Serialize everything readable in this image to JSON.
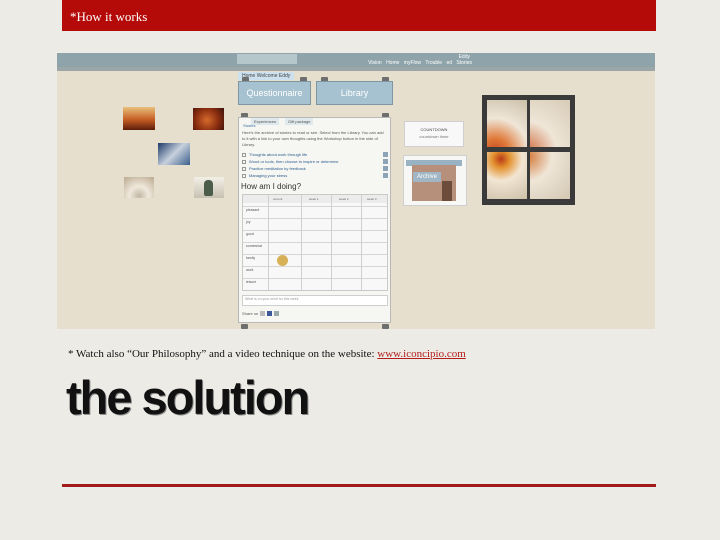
{
  "slide": {
    "title": "*How it works",
    "footnote_prefix": "* Watch also “Our Philosophy” and a video technique on the website: ",
    "footnote_link": "www.iconcipio.com",
    "heading": "the solution"
  },
  "screenshot": {
    "topbar": {
      "user": "Eddy",
      "nav": "Vision  Home  myFlow  Trouble ed  Stories"
    },
    "crumb": "Home  Welcome Eddy",
    "tabs": [
      "Questionnaire",
      "Library"
    ],
    "panel": {
      "tabs": [
        "Experiences",
        "Gift package"
      ],
      "subtab": "Stories",
      "intro": "Here's the archive of stories to read or see. Select from the Library. You can add to it with a link to your own thoughts using the Workshop button in the side of Library.",
      "items": [
        "Thoughts about work through life",
        "Wood or tools, then choose to inspire or determine",
        "Practice meditation by feedback",
        "Managing your stress"
      ],
      "doing_title": "How am I doing?",
      "grid_headers": [
        "current",
        "week 1",
        "week 2",
        "week 3"
      ],
      "rows": [
        "pleasant",
        "joy",
        "good",
        "somewhat",
        "family",
        "work",
        "leisure"
      ],
      "comment_placeholder": "What is on your mind for this week",
      "share_label": "Share on"
    },
    "countdown": {
      "title": "COUNTDOWN",
      "sub": "countdown timer"
    },
    "archive_label": "Archive"
  },
  "colors": {
    "header_red": "#b40a08",
    "rule_red": "#a31a1a",
    "link": "#b21d1a"
  }
}
